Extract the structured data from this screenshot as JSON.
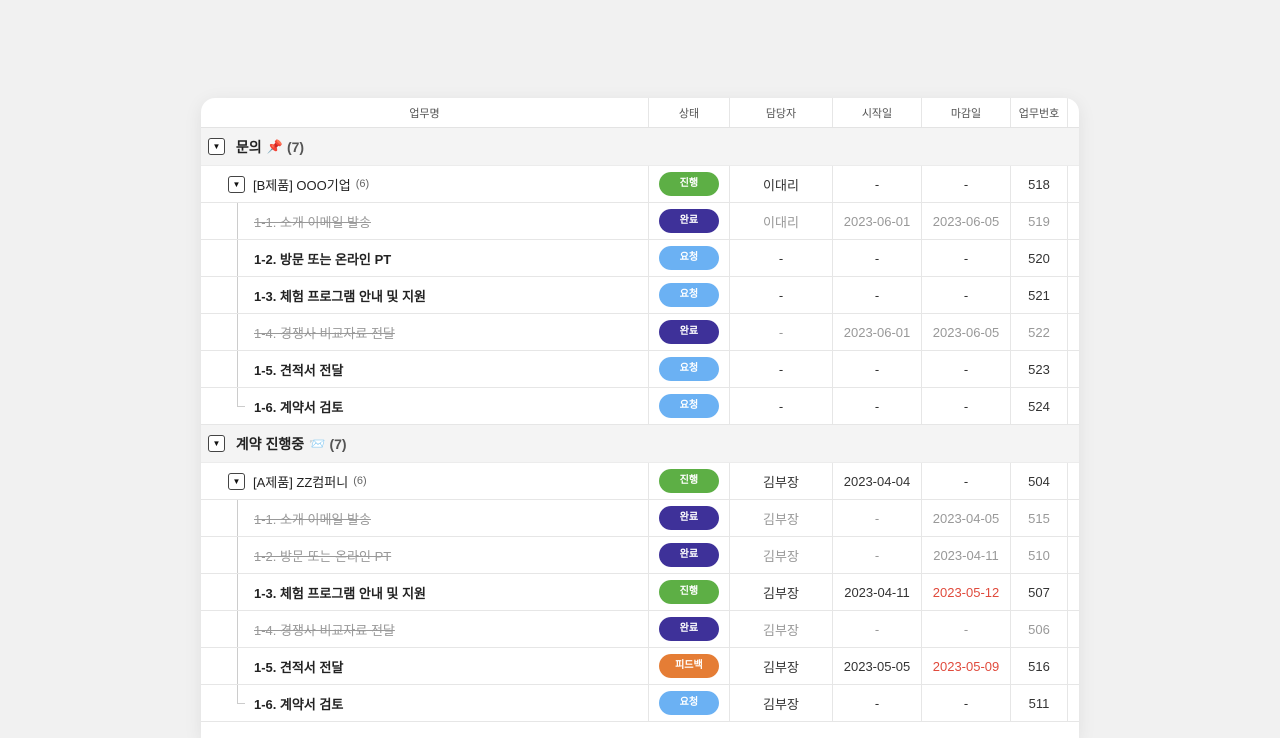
{
  "colors": {
    "status_진행": "#5daf45",
    "status_완료": "#3e3199",
    "status_요청": "#6bb1f3",
    "status_피드백": "#e57d35",
    "overdue": "#e04b3d"
  },
  "header": {
    "name": "업무명",
    "status": "상태",
    "owner": "담당자",
    "start": "시작일",
    "due": "마감일",
    "no": "업무번호"
  },
  "groups": [
    {
      "title": "문의",
      "emoji": "📌",
      "count": "(7)",
      "parent": {
        "title": "[B제품] OOO기업",
        "count": "(6)",
        "status": "진행",
        "owner": "이대리",
        "start": "-",
        "due": "-",
        "no": "518"
      },
      "tasks": [
        {
          "title": "1-1. 소개 이메일 발송",
          "done": true,
          "status": "완료",
          "owner": "이대리",
          "start": "2023-06-01",
          "due": "2023-06-05",
          "due_overdue": false,
          "no": "519"
        },
        {
          "title": "1-2. 방문 또는 온라인 PT",
          "done": false,
          "status": "요청",
          "owner": "-",
          "start": "-",
          "due": "-",
          "due_overdue": false,
          "no": "520"
        },
        {
          "title": "1-3. 체험 프로그램 안내 및 지원",
          "done": false,
          "status": "요청",
          "owner": "-",
          "start": "-",
          "due": "-",
          "due_overdue": false,
          "no": "521"
        },
        {
          "title": "1-4. 경쟁사 비교자료 전달",
          "done": true,
          "status": "완료",
          "owner": "-",
          "start": "2023-06-01",
          "due": "2023-06-05",
          "due_overdue": false,
          "no": "522"
        },
        {
          "title": "1-5. 견적서 전달",
          "done": false,
          "status": "요청",
          "owner": "-",
          "start": "-",
          "due": "-",
          "due_overdue": false,
          "no": "523"
        },
        {
          "title": "1-6. 계약서 검토",
          "done": false,
          "status": "요청",
          "owner": "-",
          "start": "-",
          "due": "-",
          "due_overdue": false,
          "no": "524"
        }
      ]
    },
    {
      "title": "계약 진행중",
      "emoji": "📨",
      "count": "(7)",
      "parent": {
        "title": "[A제품] ZZ컴퍼니",
        "count": "(6)",
        "status": "진행",
        "owner": "김부장",
        "start": "2023-04-04",
        "due": "-",
        "no": "504"
      },
      "tasks": [
        {
          "title": "1-1. 소개 이메일 발송",
          "done": true,
          "status": "완료",
          "owner": "김부장",
          "start": "-",
          "due": "2023-04-05",
          "due_overdue": false,
          "no": "515"
        },
        {
          "title": "1-2. 방문 또는 온라인 PT",
          "done": true,
          "status": "완료",
          "owner": "김부장",
          "start": "-",
          "due": "2023-04-11",
          "due_overdue": false,
          "no": "510"
        },
        {
          "title": "1-3. 체험 프로그램 안내 및 지원",
          "done": false,
          "status": "진행",
          "owner": "김부장",
          "start": "2023-04-11",
          "due": "2023-05-12",
          "due_overdue": true,
          "no": "507"
        },
        {
          "title": "1-4. 경쟁사 비교자료 전달",
          "done": true,
          "status": "완료",
          "owner": "김부장",
          "start": "-",
          "due": "-",
          "due_overdue": false,
          "no": "506"
        },
        {
          "title": "1-5. 견적서 전달",
          "done": false,
          "status": "피드백",
          "owner": "김부장",
          "start": "2023-05-05",
          "due": "2023-05-09",
          "due_overdue": true,
          "no": "516"
        },
        {
          "title": "1-6. 계약서 검토",
          "done": false,
          "status": "요청",
          "owner": "김부장",
          "start": "-",
          "due": "-",
          "due_overdue": false,
          "no": "511"
        }
      ]
    }
  ]
}
